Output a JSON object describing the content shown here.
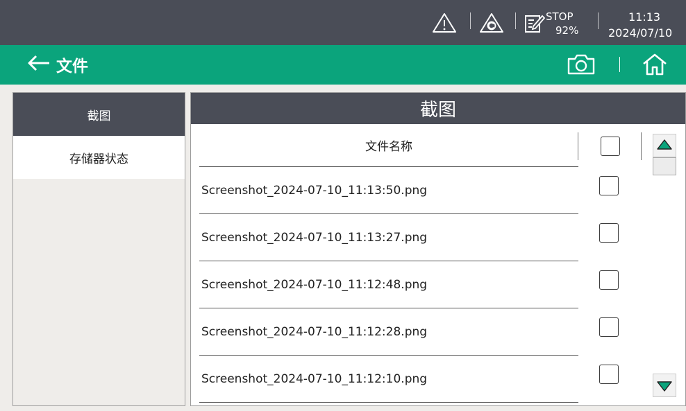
{
  "status_bar": {
    "stop_label": "STOP",
    "battery": "92%",
    "time": "11:13",
    "date": "2024/07/10"
  },
  "header": {
    "title": "文件"
  },
  "sidebar": {
    "items": [
      {
        "label": "截图"
      },
      {
        "label": "存储器状态"
      }
    ]
  },
  "panel": {
    "title": "截图",
    "column_header": "文件名称"
  },
  "files": [
    "Screenshot_2024-07-10_11:13:50.png",
    "Screenshot_2024-07-10_11:13:27.png",
    "Screenshot_2024-07-10_11:12:48.png",
    "Screenshot_2024-07-10_11:12:28.png",
    "Screenshot_2024-07-10_11:12:10.png"
  ],
  "icons": {
    "warning": "warning-icon",
    "alarm": "alarm-c-icon",
    "program": "program-edit-icon",
    "back": "back-arrow-icon",
    "camera": "camera-icon",
    "home": "home-icon",
    "up": "triangle-up-icon",
    "down": "triangle-down-icon"
  },
  "colors": {
    "status_bar": "#4a4d57",
    "header": "#0ba47c",
    "accent_arrow": "#0ba47c"
  }
}
